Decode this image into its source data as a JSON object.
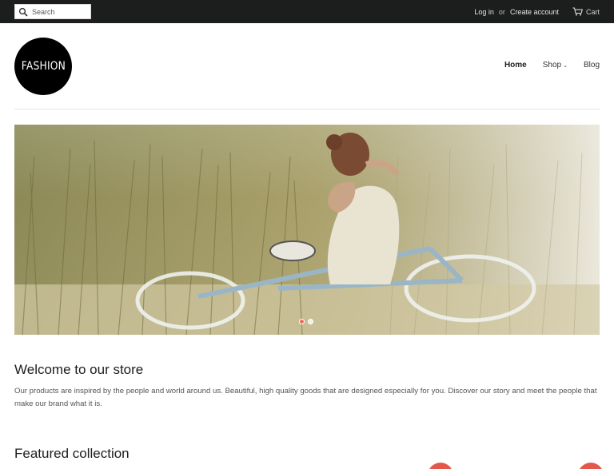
{
  "topbar": {
    "search_placeholder": "Search",
    "login": "Log in",
    "separator": "or",
    "create_account": "Create account",
    "cart": "Cart"
  },
  "header": {
    "logo_text": "FASHION",
    "nav": [
      {
        "label": "Home",
        "active": true
      },
      {
        "label": "Shop",
        "dropdown": true
      },
      {
        "label": "Blog"
      }
    ]
  },
  "hero": {
    "slides": 2,
    "active_slide": 1
  },
  "welcome": {
    "title": "Welcome to our store",
    "text": "Our products are inspired by the people and world around us. Beautiful, high quality goods that are designed especially for you. Discover our story and meet the people that make our brand what it is."
  },
  "featured": {
    "title": "Featured collection"
  },
  "colors": {
    "topbar": "#1c1d1d",
    "accent": "#e2594c"
  }
}
